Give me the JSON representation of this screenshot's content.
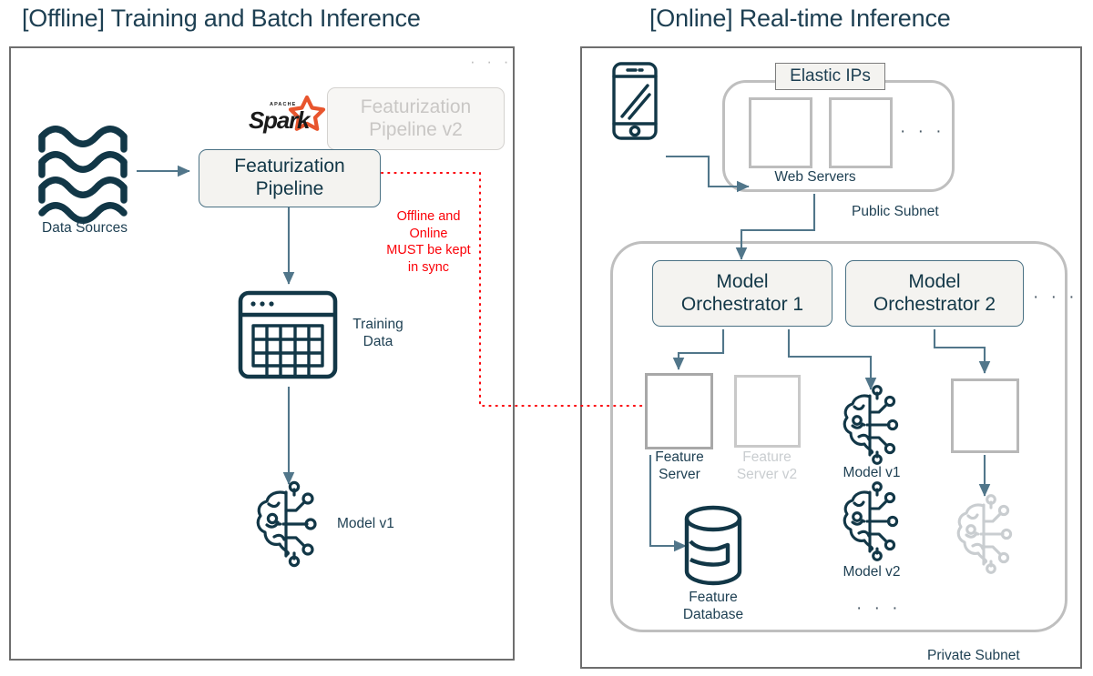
{
  "titles": {
    "offline": "[Offline] Training and Batch Inference",
    "online": "[Online] Real-time Inference"
  },
  "colors": {
    "text_dark": "#1d3f52",
    "panel_border": "#6e6e6e",
    "box_fill": "#f4f3f0",
    "box_border": "#4a7184",
    "arrow": "#51768a",
    "ghost_gray": "#c9cdd0",
    "subnet_gray": "#bfbfbf",
    "warning_red": "#fb0007",
    "spark_orange": "#e8552d",
    "icon_navy": "#123747"
  },
  "offline": {
    "data_sources": {
      "label": "Data Sources",
      "icon": "waves-icon"
    },
    "featurization_pipeline": {
      "label": "Featurization\nPipeline"
    },
    "featurization_pipeline_v2": {
      "label": "Featurization\nPipeline v2"
    },
    "spark_logo": {
      "top_text": "APACHE",
      "word": "Spark",
      "icon": "apache-spark-logo"
    },
    "more_versions_ellipsis": "· · ·",
    "training_data": {
      "label": "Training\nData",
      "icon": "spreadsheet-icon"
    },
    "model": {
      "label": "Model v1",
      "icon": "brain-circuit-icon"
    },
    "sync_warning": "Offline and\nOnline\nMUST be kept\nin sync"
  },
  "online": {
    "client_device": {
      "icon": "mobile-phone-icon"
    },
    "elastic_ips": {
      "label": "Elastic IPs"
    },
    "web_servers": {
      "label": "Web Servers",
      "icon": "server-rack-icon",
      "ellipsis": "· · ·"
    },
    "public_subnet": {
      "label": "Public Subnet"
    },
    "private_subnet": {
      "label": "Private Subnet"
    },
    "orchestrators": [
      {
        "label": "Model\nOrchestrator 1"
      },
      {
        "label": "Model\nOrchestrator 2"
      }
    ],
    "orchestrator_ellipsis": "· · ·",
    "feature_server": {
      "label": "Feature\nServer",
      "icon": "server-rack-icon"
    },
    "feature_server_v2": {
      "label": "Feature\nServer v2",
      "icon": "server-rack-icon"
    },
    "feature_database": {
      "label": "Feature\nDatabase",
      "icon": "database-cylinder-icon"
    },
    "model_v1": {
      "label": "Model v1",
      "icon": "brain-circuit-icon"
    },
    "model_v2": {
      "label": "Model v2",
      "icon": "brain-circuit-icon"
    },
    "models_ellipsis": "· · ·",
    "server_v2_right": {
      "icon": "server-rack-icon"
    },
    "model_ghost": {
      "icon": "brain-circuit-icon"
    }
  }
}
